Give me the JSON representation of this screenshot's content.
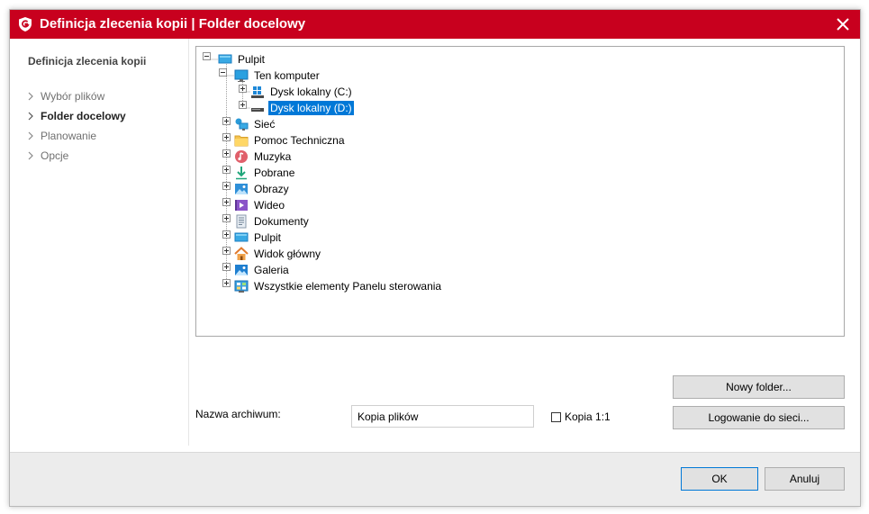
{
  "window": {
    "title": "Definicja zlecenia kopii | Folder docelowy",
    "accent_color": "#c8001e",
    "logo_icon": "gdata-shield-icon",
    "close_icon": "close-icon"
  },
  "sidebar": {
    "title": "Definicja zlecenia kopii",
    "items": [
      {
        "label": "Wybór plików",
        "active": false
      },
      {
        "label": "Folder docelowy",
        "active": true
      },
      {
        "label": "Planowanie",
        "active": false
      },
      {
        "label": "Opcje",
        "active": false
      }
    ]
  },
  "tree": {
    "root": "Pulpit",
    "computer": "Ten komputer",
    "drive_c": "Dysk lokalny (C:)",
    "drive_d": "Dysk lokalny (D:)",
    "selected": "Dysk lokalny (D:)",
    "items": [
      {
        "label": "Sieć",
        "icon": "network-icon"
      },
      {
        "label": "Pomoc Techniczna",
        "icon": "folder-icon"
      },
      {
        "label": "Muzyka",
        "icon": "music-icon"
      },
      {
        "label": "Pobrane",
        "icon": "download-icon"
      },
      {
        "label": "Obrazy",
        "icon": "pictures-icon"
      },
      {
        "label": "Wideo",
        "icon": "video-icon"
      },
      {
        "label": "Dokumenty",
        "icon": "documents-icon"
      },
      {
        "label": "Pulpit",
        "icon": "desktop-icon"
      },
      {
        "label": "Widok główny",
        "icon": "home-icon"
      },
      {
        "label": "Galeria",
        "icon": "gallery-icon"
      },
      {
        "label": "Wszystkie elementy Panelu sterowania",
        "icon": "control-panel-icon"
      }
    ]
  },
  "buttons": {
    "new_folder": "Nowy folder...",
    "network_login": "Logowanie do sieci...",
    "ok": "OK",
    "cancel": "Anuluj"
  },
  "archive": {
    "label": "Nazwa archiwum:",
    "value": "Kopia plików"
  },
  "copy_option": {
    "label": "Kopia 1:1",
    "checked": false
  }
}
